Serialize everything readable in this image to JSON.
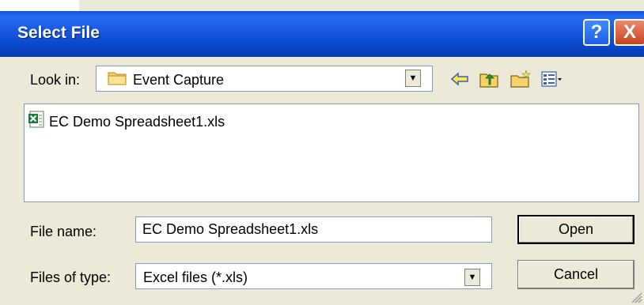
{
  "window": {
    "title": "Select File",
    "help_glyph": "?",
    "close_glyph": "X",
    "colors": {
      "titlebar": "#0a4fd6",
      "close": "#c8431f",
      "background": "#ece9d8"
    }
  },
  "lookin": {
    "label": "Look in:",
    "value": "Event Capture",
    "folder_icon": "folder-icon"
  },
  "toolbar": {
    "icons": [
      "back-arrow-icon",
      "up-folder-icon",
      "new-folder-icon",
      "views-menu-icon"
    ]
  },
  "filelist": {
    "items": [
      {
        "name": "EC Demo Spreadsheet1.xls",
        "icon": "excel-file-icon"
      }
    ]
  },
  "filename": {
    "label": "File name:",
    "value": "EC Demo Spreadsheet1.xls"
  },
  "filetype": {
    "label": "Files of type:",
    "value": "Excel files (*.xls)"
  },
  "buttons": {
    "open": "Open",
    "cancel": "Cancel"
  }
}
